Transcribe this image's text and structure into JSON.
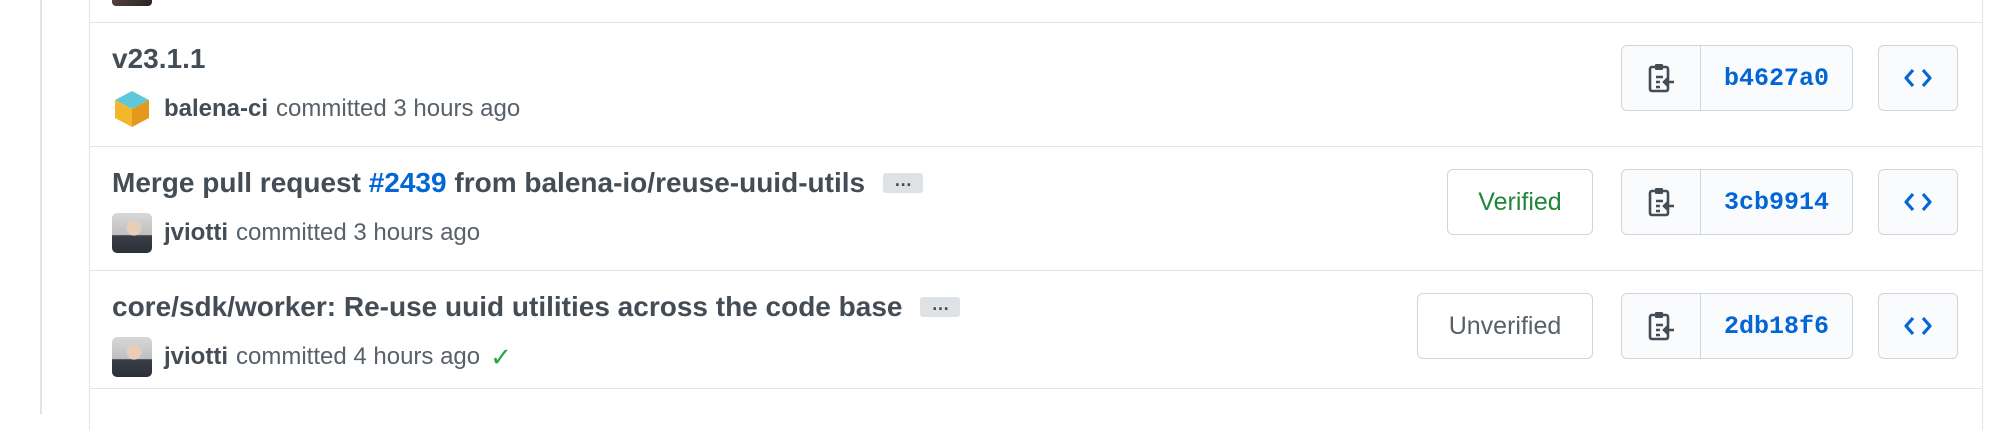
{
  "commits": [
    {
      "title_parts": [
        "v23.1.1"
      ],
      "pr_link": null,
      "has_ellipsis": false,
      "avatar": "balena-cube",
      "author": "balena-ci",
      "action": "committed 3 hours ago",
      "status_check": false,
      "badge": null,
      "sha": "b4627a0"
    },
    {
      "title_parts": [
        "Merge pull request ",
        "#2439",
        " from balena-io/reuse-uuid-utils"
      ],
      "has_ellipsis": true,
      "avatar": "person",
      "author": "jviotti",
      "action": "committed 3 hours ago",
      "status_check": false,
      "badge": "Verified",
      "sha": "3cb9914"
    },
    {
      "title_parts": [
        "core/sdk/worker: Re-use uuid utilities across the code base"
      ],
      "has_ellipsis": true,
      "avatar": "person",
      "author": "jviotti",
      "action": "committed 4 hours ago",
      "status_check": true,
      "badge": "Unverified",
      "sha": "2db18f6"
    }
  ],
  "ellipsis_label": "…",
  "check_mark": "✓",
  "icons": {
    "copy": "clippy-icon",
    "browse": "code-icon",
    "avatar_ci": "balena-cube-icon"
  },
  "colors": {
    "link": "#0366d6",
    "verified": "#22863a",
    "check": "#28a745"
  }
}
